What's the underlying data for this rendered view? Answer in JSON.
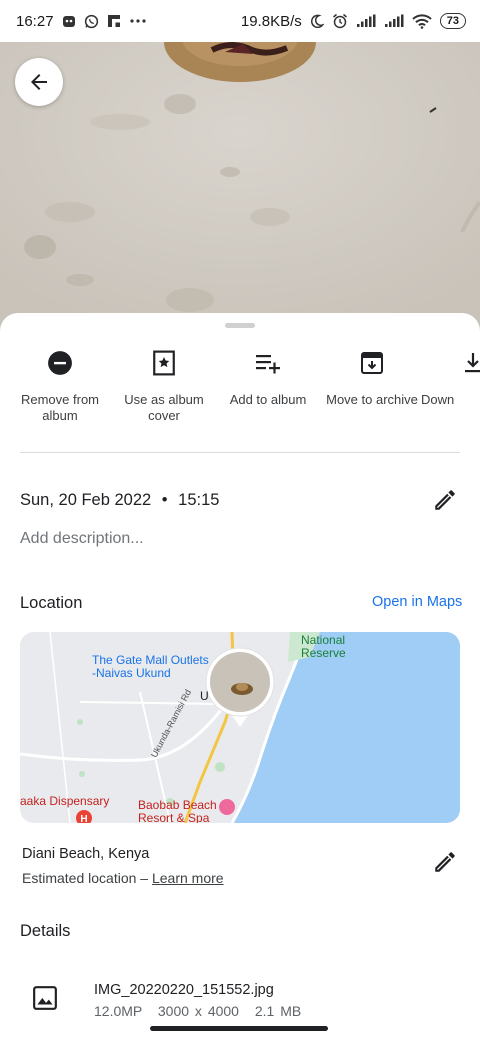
{
  "status_bar": {
    "time": "16:27",
    "speed": "19.8KB/s",
    "battery": "73",
    "icons": [
      "notification-icon",
      "whatsapp-icon",
      "flipboard-icon",
      "more-dots-icon",
      "moon-icon",
      "alarm-icon",
      "signal-icon",
      "wifi-icon",
      "battery-icon"
    ]
  },
  "actions": [
    {
      "label": "Remove from album",
      "icon": "remove-circle-icon"
    },
    {
      "label": "Use as album cover",
      "icon": "album-cover-icon"
    },
    {
      "label": "Add to album",
      "icon": "playlist-add-icon"
    },
    {
      "label": "Move to archive",
      "icon": "archive-icon"
    },
    {
      "label": "Down",
      "icon": "download-icon"
    }
  ],
  "datetime": {
    "date": "Sun, 20 Feb 2022",
    "separator": "•",
    "time": "15:15"
  },
  "description": {
    "placeholder": "Add description..."
  },
  "location": {
    "title": "Location",
    "open_maps": "Open in Maps",
    "map_labels": {
      "mall": "The Gate Mall Outlets\n-Naivas Ukund",
      "reserve": "National\nReserve",
      "road": "Ukunda-Ramisi Rd",
      "dispensary": "aaka Dispensary",
      "resort": "Baobab Beach\nResort & Spa",
      "town_fragment": "U"
    },
    "place_name": "Diani Beach, Kenya",
    "estimated": "Estimated location –",
    "learn_more": "Learn more"
  },
  "details": {
    "title": "Details",
    "file_name": "IMG_20220220_151552.jpg",
    "megapixels": "12.0MP",
    "resolution": "3000 x 4000",
    "size": "2.1 MB"
  },
  "colors": {
    "accent": "#1a73e8",
    "sea": "#9fcdf6",
    "land": "#e8eaed",
    "sand": "#d3cec6"
  }
}
